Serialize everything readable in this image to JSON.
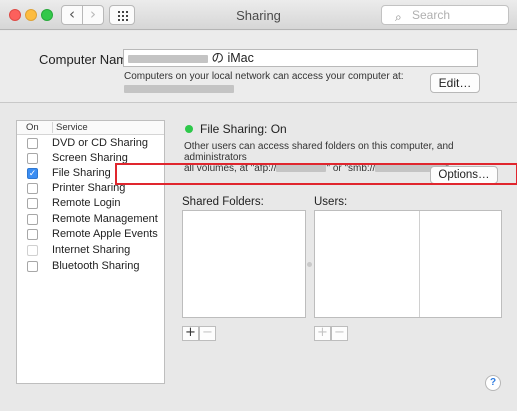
{
  "window": {
    "title": "Sharing",
    "search_placeholder": "Search",
    "back_glyph": "‹",
    "forward_glyph": "›"
  },
  "computer": {
    "label": "Computer Name:",
    "name_suffix": "の iMac",
    "note": "Computers on your local network can access your computer at:",
    "edit_label": "Edit…"
  },
  "services": {
    "header_on": "On",
    "header_service": "Service",
    "items": [
      {
        "label": "DVD or CD Sharing",
        "checked": false
      },
      {
        "label": "Screen Sharing",
        "checked": false
      },
      {
        "label": "File Sharing",
        "checked": true
      },
      {
        "label": "Printer Sharing",
        "checked": false
      },
      {
        "label": "Remote Login",
        "checked": false
      },
      {
        "label": "Remote Management",
        "checked": false
      },
      {
        "label": "Remote Apple Events",
        "checked": false
      },
      {
        "label": "Internet Sharing",
        "checked": false
      },
      {
        "label": "Bluetooth Sharing",
        "checked": false
      }
    ]
  },
  "detail": {
    "status": "File Sharing: On",
    "status_color": "#2dc84a",
    "desc_line1": "Other users can access shared folders on this computer, and administrators",
    "desc_line2_a": "all volumes, at \"afp://",
    "desc_line2_b": "\" or \"smb://",
    "desc_line2_c": "\".",
    "options_label": "Options…",
    "shared_folders_label": "Shared Folders:",
    "users_label": "Users:",
    "add_glyph": "+",
    "remove_glyph": "−"
  },
  "highlight_color": "#e0262e",
  "help_glyph": "?"
}
